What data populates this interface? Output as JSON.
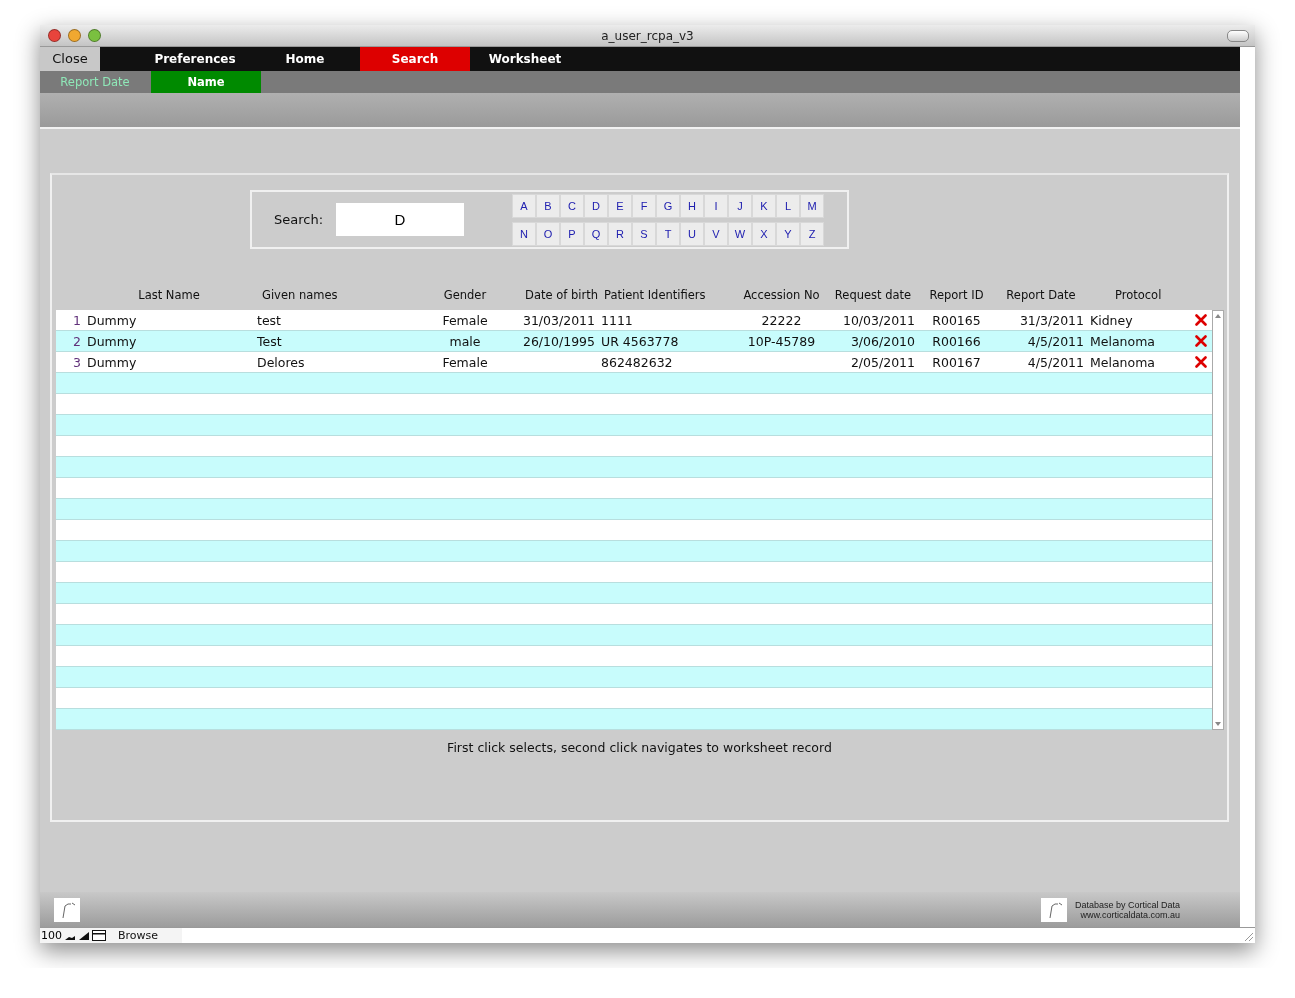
{
  "window": {
    "title": "a_user_rcpa_v3"
  },
  "nav": {
    "close": "Close",
    "tabs": [
      {
        "label": "Preferences",
        "selected": false
      },
      {
        "label": "Home",
        "selected": false
      },
      {
        "label": "Search",
        "selected": true
      },
      {
        "label": "Worksheet",
        "selected": false
      }
    ]
  },
  "sort_tabs": [
    {
      "label": "Report Date",
      "selected": false
    },
    {
      "label": "Name",
      "selected": true
    }
  ],
  "search": {
    "label": "Search:",
    "value": "D",
    "letters": [
      "A",
      "B",
      "C",
      "D",
      "E",
      "F",
      "G",
      "H",
      "I",
      "J",
      "K",
      "L",
      "M",
      "N",
      "O",
      "P",
      "Q",
      "R",
      "S",
      "T",
      "U",
      "V",
      "W",
      "X",
      "Y",
      "Z"
    ]
  },
  "table": {
    "columns": [
      "Last Name",
      "Given names",
      "Gender",
      "Date of birth",
      "Patient Identifiers",
      "Accession No",
      "Request date",
      "Report ID",
      "Report Date",
      "Protocol"
    ],
    "rows": [
      {
        "number": "1",
        "cells": [
          "Dummy",
          "test",
          "Female",
          "31/03/2011",
          "1111",
          "22222",
          "10/03/2011",
          "R00165",
          "31/3/2011",
          "Kidney"
        ]
      },
      {
        "number": "2",
        "cells": [
          "Dummy",
          "Test",
          "male",
          "26/10/1995",
          "UR 4563778",
          "10P-45789",
          "3/06/2010",
          "R00166",
          "4/5/2011",
          "Melanoma"
        ]
      },
      {
        "number": "3",
        "cells": [
          "Dummy",
          "Delores",
          "Female",
          "",
          "862482632",
          "",
          "2/05/2011",
          "R00167",
          "4/5/2011",
          "Melanoma"
        ]
      }
    ]
  },
  "hint": "First click selects, second click navigates to worksheet record",
  "credit": [
    "Database by Cortical Data",
    "www.corticaldata.com.au"
  ],
  "status_bar": {
    "zoom": "100",
    "mode": "Browse"
  }
}
